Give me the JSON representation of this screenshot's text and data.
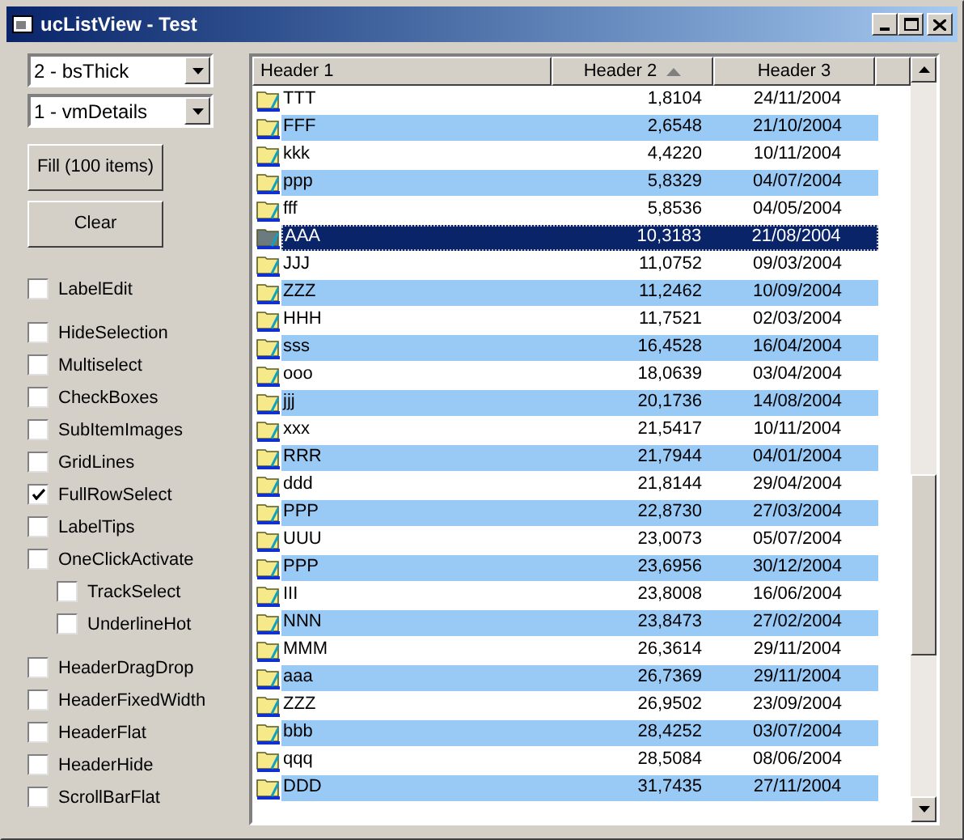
{
  "window": {
    "title": "ucListView - Test"
  },
  "dropdowns": [
    {
      "value": "2 - bsThick"
    },
    {
      "value": "1 - vmDetails"
    }
  ],
  "buttons": [
    "Fill (100 items)",
    "Clear"
  ],
  "option_groups": [
    [
      {
        "label": "LabelEdit",
        "checked": false
      }
    ],
    [
      {
        "label": "HideSelection",
        "checked": false
      },
      {
        "label": "Multiselect",
        "checked": false
      },
      {
        "label": "CheckBoxes",
        "checked": false
      },
      {
        "label": "SubItemImages",
        "checked": false
      },
      {
        "label": "GridLines",
        "checked": false
      },
      {
        "label": "FullRowSelect",
        "checked": true
      },
      {
        "label": "LabelTips",
        "checked": false
      },
      {
        "label": "OneClickActivate",
        "checked": false,
        "children": [
          {
            "label": "TrackSelect",
            "checked": false
          },
          {
            "label": "UnderlineHot",
            "checked": false
          }
        ]
      }
    ],
    [
      {
        "label": "HeaderDragDrop",
        "checked": false
      },
      {
        "label": "HeaderFixedWidth",
        "checked": false
      },
      {
        "label": "HeaderFlat",
        "checked": false
      },
      {
        "label": "HeaderHide",
        "checked": false
      },
      {
        "label": "ScrollBarFlat",
        "checked": false
      }
    ]
  ],
  "list": {
    "columns": [
      {
        "label": "Header 1",
        "sorted": false
      },
      {
        "label": "Header 2",
        "sorted": true
      },
      {
        "label": "Header 3",
        "sorted": false
      }
    ],
    "rows": [
      {
        "cells": [
          "TTT",
          "1,8104",
          "24/11/2004"
        ],
        "selected": false
      },
      {
        "cells": [
          "FFF",
          "2,6548",
          "21/10/2004"
        ],
        "selected": false
      },
      {
        "cells": [
          "kkk",
          "4,4220",
          "10/11/2004"
        ],
        "selected": false
      },
      {
        "cells": [
          "ppp",
          "5,8329",
          "04/07/2004"
        ],
        "selected": false
      },
      {
        "cells": [
          "fff",
          "5,8536",
          "04/05/2004"
        ],
        "selected": false
      },
      {
        "cells": [
          "AAA",
          "10,3183",
          "21/08/2004"
        ],
        "selected": true
      },
      {
        "cells": [
          "JJJ",
          "11,0752",
          "09/03/2004"
        ],
        "selected": false
      },
      {
        "cells": [
          "ZZZ",
          "11,2462",
          "10/09/2004"
        ],
        "selected": false
      },
      {
        "cells": [
          "HHH",
          "11,7521",
          "02/03/2004"
        ],
        "selected": false
      },
      {
        "cells": [
          "sss",
          "16,4528",
          "16/04/2004"
        ],
        "selected": false
      },
      {
        "cells": [
          "ooo",
          "18,0639",
          "03/04/2004"
        ],
        "selected": false
      },
      {
        "cells": [
          "jjj",
          "20,1736",
          "14/08/2004"
        ],
        "selected": false
      },
      {
        "cells": [
          "xxx",
          "21,5417",
          "10/11/2004"
        ],
        "selected": false
      },
      {
        "cells": [
          "RRR",
          "21,7944",
          "04/01/2004"
        ],
        "selected": false
      },
      {
        "cells": [
          "ddd",
          "21,8144",
          "29/04/2004"
        ],
        "selected": false
      },
      {
        "cells": [
          "PPP",
          "22,8730",
          "27/03/2004"
        ],
        "selected": false
      },
      {
        "cells": [
          "UUU",
          "23,0073",
          "05/07/2004"
        ],
        "selected": false
      },
      {
        "cells": [
          "PPP",
          "23,6956",
          "30/12/2004"
        ],
        "selected": false
      },
      {
        "cells": [
          "III",
          "23,8008",
          "16/06/2004"
        ],
        "selected": false
      },
      {
        "cells": [
          "NNN",
          "23,8473",
          "27/02/2004"
        ],
        "selected": false
      },
      {
        "cells": [
          "MMM",
          "26,3614",
          "29/11/2004"
        ],
        "selected": false
      },
      {
        "cells": [
          "aaa",
          "26,7369",
          "29/11/2004"
        ],
        "selected": false
      },
      {
        "cells": [
          "ZZZ",
          "26,9502",
          "23/09/2004"
        ],
        "selected": false
      },
      {
        "cells": [
          "bbb",
          "28,4252",
          "03/07/2004"
        ],
        "selected": false
      },
      {
        "cells": [
          "qqq",
          "28,5084",
          "08/06/2004"
        ],
        "selected": false
      },
      {
        "cells": [
          "DDD",
          "31,7435",
          "27/11/2004"
        ],
        "selected": false
      }
    ]
  }
}
